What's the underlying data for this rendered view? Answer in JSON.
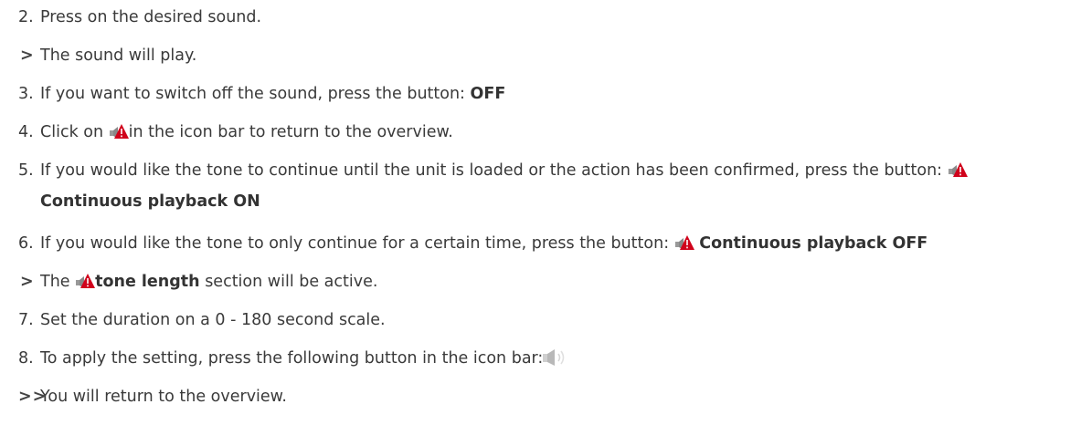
{
  "steps": [
    {
      "marker": "2.",
      "text": "Press on the desired sound."
    },
    {
      "marker": ">",
      "text": "The sound will play."
    },
    {
      "marker": "3.",
      "pre": "If you want to switch off the sound, press the button: ",
      "bold": "OFF"
    },
    {
      "marker": "4.",
      "pre": "Click on ",
      "post": "in the icon bar to return to the overview."
    },
    {
      "marker": "5.",
      "pre": "If you would like the tone to continue until the unit is loaded or the action has been confirmed, press the button: ",
      "bold": "Continuous playback ON"
    },
    {
      "marker": "6.",
      "pre": "If you would like the tone to only continue for a certain time, press the button: ",
      "bold": "Continuous playback OFF"
    },
    {
      "marker": ">",
      "pre": "The ",
      "bold": "tone length",
      "post": " section will be active."
    },
    {
      "marker": "7.",
      "text": "Set the duration on a 0 - 180 second scale."
    },
    {
      "marker": "8.",
      "pre": "To apply the setting, press the following button in the icon bar:"
    },
    {
      "marker": ">>",
      "text": "You will return to the overview."
    }
  ],
  "icons": {
    "alarm": "alarm-speaker-icon",
    "sound": "speaker-icon",
    "accent": "#d0021b"
  }
}
